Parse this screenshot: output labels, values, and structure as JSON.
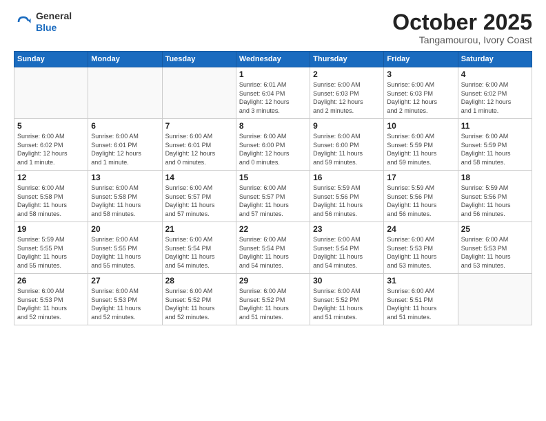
{
  "logo": {
    "general": "General",
    "blue": "Blue"
  },
  "header": {
    "month": "October 2025",
    "location": "Tangamourou, Ivory Coast"
  },
  "weekdays": [
    "Sunday",
    "Monday",
    "Tuesday",
    "Wednesday",
    "Thursday",
    "Friday",
    "Saturday"
  ],
  "weeks": [
    [
      {
        "day": "",
        "info": ""
      },
      {
        "day": "",
        "info": ""
      },
      {
        "day": "",
        "info": ""
      },
      {
        "day": "1",
        "info": "Sunrise: 6:01 AM\nSunset: 6:04 PM\nDaylight: 12 hours\nand 3 minutes."
      },
      {
        "day": "2",
        "info": "Sunrise: 6:00 AM\nSunset: 6:03 PM\nDaylight: 12 hours\nand 2 minutes."
      },
      {
        "day": "3",
        "info": "Sunrise: 6:00 AM\nSunset: 6:03 PM\nDaylight: 12 hours\nand 2 minutes."
      },
      {
        "day": "4",
        "info": "Sunrise: 6:00 AM\nSunset: 6:02 PM\nDaylight: 12 hours\nand 1 minute."
      }
    ],
    [
      {
        "day": "5",
        "info": "Sunrise: 6:00 AM\nSunset: 6:02 PM\nDaylight: 12 hours\nand 1 minute."
      },
      {
        "day": "6",
        "info": "Sunrise: 6:00 AM\nSunset: 6:01 PM\nDaylight: 12 hours\nand 1 minute."
      },
      {
        "day": "7",
        "info": "Sunrise: 6:00 AM\nSunset: 6:01 PM\nDaylight: 12 hours\nand 0 minutes."
      },
      {
        "day": "8",
        "info": "Sunrise: 6:00 AM\nSunset: 6:00 PM\nDaylight: 12 hours\nand 0 minutes."
      },
      {
        "day": "9",
        "info": "Sunrise: 6:00 AM\nSunset: 6:00 PM\nDaylight: 11 hours\nand 59 minutes."
      },
      {
        "day": "10",
        "info": "Sunrise: 6:00 AM\nSunset: 5:59 PM\nDaylight: 11 hours\nand 59 minutes."
      },
      {
        "day": "11",
        "info": "Sunrise: 6:00 AM\nSunset: 5:59 PM\nDaylight: 11 hours\nand 58 minutes."
      }
    ],
    [
      {
        "day": "12",
        "info": "Sunrise: 6:00 AM\nSunset: 5:58 PM\nDaylight: 11 hours\nand 58 minutes."
      },
      {
        "day": "13",
        "info": "Sunrise: 6:00 AM\nSunset: 5:58 PM\nDaylight: 11 hours\nand 58 minutes."
      },
      {
        "day": "14",
        "info": "Sunrise: 6:00 AM\nSunset: 5:57 PM\nDaylight: 11 hours\nand 57 minutes."
      },
      {
        "day": "15",
        "info": "Sunrise: 6:00 AM\nSunset: 5:57 PM\nDaylight: 11 hours\nand 57 minutes."
      },
      {
        "day": "16",
        "info": "Sunrise: 5:59 AM\nSunset: 5:56 PM\nDaylight: 11 hours\nand 56 minutes."
      },
      {
        "day": "17",
        "info": "Sunrise: 5:59 AM\nSunset: 5:56 PM\nDaylight: 11 hours\nand 56 minutes."
      },
      {
        "day": "18",
        "info": "Sunrise: 5:59 AM\nSunset: 5:56 PM\nDaylight: 11 hours\nand 56 minutes."
      }
    ],
    [
      {
        "day": "19",
        "info": "Sunrise: 5:59 AM\nSunset: 5:55 PM\nDaylight: 11 hours\nand 55 minutes."
      },
      {
        "day": "20",
        "info": "Sunrise: 6:00 AM\nSunset: 5:55 PM\nDaylight: 11 hours\nand 55 minutes."
      },
      {
        "day": "21",
        "info": "Sunrise: 6:00 AM\nSunset: 5:54 PM\nDaylight: 11 hours\nand 54 minutes."
      },
      {
        "day": "22",
        "info": "Sunrise: 6:00 AM\nSunset: 5:54 PM\nDaylight: 11 hours\nand 54 minutes."
      },
      {
        "day": "23",
        "info": "Sunrise: 6:00 AM\nSunset: 5:54 PM\nDaylight: 11 hours\nand 54 minutes."
      },
      {
        "day": "24",
        "info": "Sunrise: 6:00 AM\nSunset: 5:53 PM\nDaylight: 11 hours\nand 53 minutes."
      },
      {
        "day": "25",
        "info": "Sunrise: 6:00 AM\nSunset: 5:53 PM\nDaylight: 11 hours\nand 53 minutes."
      }
    ],
    [
      {
        "day": "26",
        "info": "Sunrise: 6:00 AM\nSunset: 5:53 PM\nDaylight: 11 hours\nand 52 minutes."
      },
      {
        "day": "27",
        "info": "Sunrise: 6:00 AM\nSunset: 5:53 PM\nDaylight: 11 hours\nand 52 minutes."
      },
      {
        "day": "28",
        "info": "Sunrise: 6:00 AM\nSunset: 5:52 PM\nDaylight: 11 hours\nand 52 minutes."
      },
      {
        "day": "29",
        "info": "Sunrise: 6:00 AM\nSunset: 5:52 PM\nDaylight: 11 hours\nand 51 minutes."
      },
      {
        "day": "30",
        "info": "Sunrise: 6:00 AM\nSunset: 5:52 PM\nDaylight: 11 hours\nand 51 minutes."
      },
      {
        "day": "31",
        "info": "Sunrise: 6:00 AM\nSunset: 5:51 PM\nDaylight: 11 hours\nand 51 minutes."
      },
      {
        "day": "",
        "info": ""
      }
    ]
  ]
}
